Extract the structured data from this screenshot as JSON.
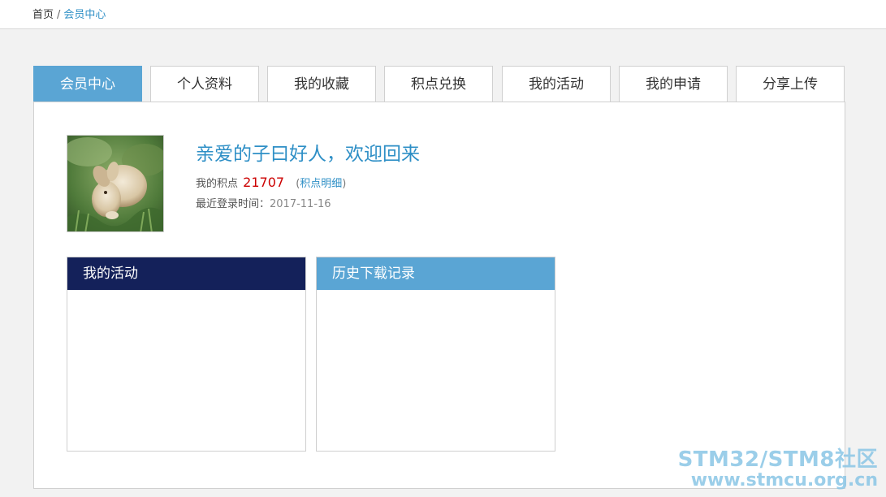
{
  "breadcrumb": {
    "home": "首页",
    "separator": "/",
    "current": "会员中心"
  },
  "tabs": [
    {
      "label": "会员中心",
      "active": true
    },
    {
      "label": "个人资料",
      "active": false
    },
    {
      "label": "我的收藏",
      "active": false
    },
    {
      "label": "积点兑换",
      "active": false
    },
    {
      "label": "我的活动",
      "active": false
    },
    {
      "label": "我的申请",
      "active": false
    },
    {
      "label": "分享上传",
      "active": false
    }
  ],
  "profile": {
    "welcome": "亲爱的子曰好人，欢迎回来",
    "points_label": "我的积点",
    "points_value": "21707",
    "points_detail_open": "(",
    "points_detail": "积点明细",
    "points_detail_close": ")",
    "login_label": "最近登录时间：",
    "login_date": "2017-11-16"
  },
  "boxes": {
    "activities_title": "我的活动",
    "downloads_title": "历史下载记录"
  },
  "watermark": {
    "line1": "STM32/STM8社区",
    "line2": "www.stmcu.org.cn"
  },
  "colors": {
    "accent": "#5aa5d4",
    "dark_header": "#14215a",
    "link": "#2e8fc6",
    "points": "#cc0000"
  }
}
